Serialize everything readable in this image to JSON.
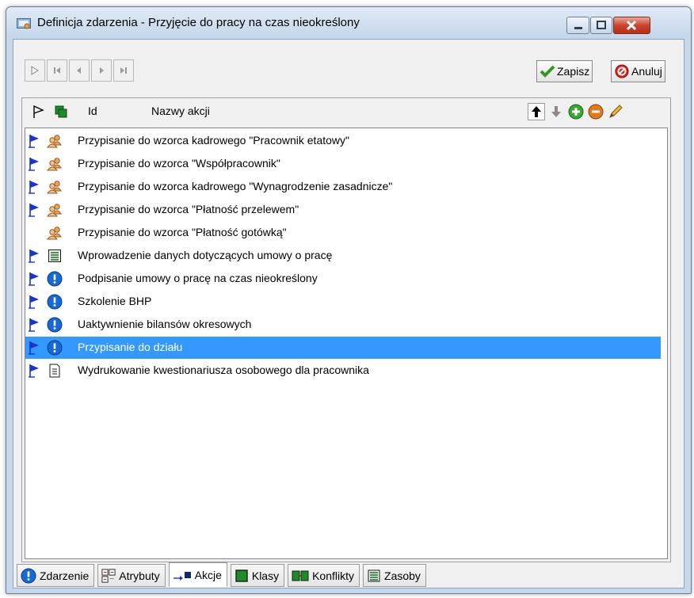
{
  "window": {
    "title": "Definicja zdarzenia - Przyjęcie do pracy na czas nieokreślony"
  },
  "toolbar": {
    "save_label": "Zapisz",
    "cancel_label": "Anuluj"
  },
  "list": {
    "columns": {
      "id": "Id",
      "name": "Nazwy akcji"
    },
    "rows": [
      {
        "flag": true,
        "type": "people-icon",
        "text": "Przypisanie do wzorca kadrowego \"Pracownik etatowy\""
      },
      {
        "flag": true,
        "type": "people-icon",
        "text": "Przypisanie do wzorca \"Współpracownik\""
      },
      {
        "flag": true,
        "type": "people-icon",
        "text": "Przypisanie do wzorca kadrowego \"Wynagrodzenie zasadnicze\""
      },
      {
        "flag": true,
        "type": "people-icon",
        "text": "Przypisanie do wzorca \"Płatność przelewem\""
      },
      {
        "flag": false,
        "type": "people-icon",
        "text": "Przypisanie do wzorca \"Płatność gotówką\""
      },
      {
        "flag": true,
        "type": "form-icon",
        "text": "Wprowadzenie danych dotyczących umowy o pracę"
      },
      {
        "flag": true,
        "type": "info-icon",
        "text": "Podpisanie umowy o pracę na czas nieokreślony"
      },
      {
        "flag": true,
        "type": "info-icon",
        "text": "Szkolenie BHP"
      },
      {
        "flag": true,
        "type": "info-icon",
        "text": "Uaktywnienie bilansów okresowych"
      },
      {
        "flag": true,
        "type": "info-icon",
        "text": "Przypisanie do działu",
        "selected": true
      },
      {
        "flag": true,
        "type": "document-icon",
        "text": "Wydrukowanie kwestionariusza osobowego dla pracownika"
      }
    ]
  },
  "tabs": [
    {
      "label": "Zdarzenie",
      "icon": "info-icon"
    },
    {
      "label": "Atrybuty",
      "icon": "attributes-icon"
    },
    {
      "label": "Akcje",
      "icon": "actions-icon",
      "active": true
    },
    {
      "label": "Klasy",
      "icon": "class-icon"
    },
    {
      "label": "Konflikty",
      "icon": "conflict-icon"
    },
    {
      "label": "Zasoby",
      "icon": "resources-icon"
    }
  ],
  "colors": {
    "selection": "#3399ff",
    "flag": "#1a33cc",
    "info": "#1769d4",
    "add": "#3aa830",
    "remove": "#e07a1a"
  }
}
